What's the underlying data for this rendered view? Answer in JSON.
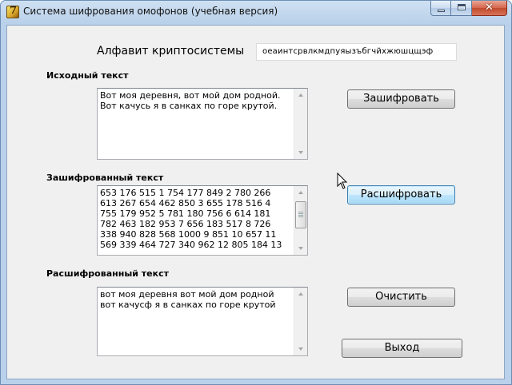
{
  "window": {
    "title": "Система шифрования омофонов (учебная версия)",
    "close_glyph": "✕"
  },
  "alphabet": {
    "label": "Алфавит криптосистемы",
    "value": "оеаинтсрвлкмдпуяызъбгчйхжюшцщэф"
  },
  "source": {
    "label": "Исходный текст",
    "text": "Вот моя деревня, вот мой дом родной.\nВот качусь я в санках по горе крутой."
  },
  "encrypted": {
    "label": "Зашифрованный текст",
    "text": "653 176 515 1 754 177 849 2 780 266\n613 267 654 462 850 3 655 178 516 4\n755 179 952 5 781 180 756 6 614 181\n782 463 182 953 7 656 183 517 8 726\n338 940 828 568 1000 9 851 10 657 11\n569 339 464 727 340 962 12 805 184 13"
  },
  "decrypted": {
    "label": "Расшифрованный текст",
    "text": "вот моя деревня вот мой дом родной\nвот качусф я в санках по горе крутой"
  },
  "buttons": {
    "encrypt": "Зашифровать",
    "decrypt": "Расшифровать",
    "clear": "Очистить",
    "exit": "Выход"
  },
  "colors": {
    "title_bar": "#b9d1ea",
    "client_bg": "#f0f0f0",
    "default_button_border": "#3c7fb1",
    "close_button": "#c14a2c"
  }
}
